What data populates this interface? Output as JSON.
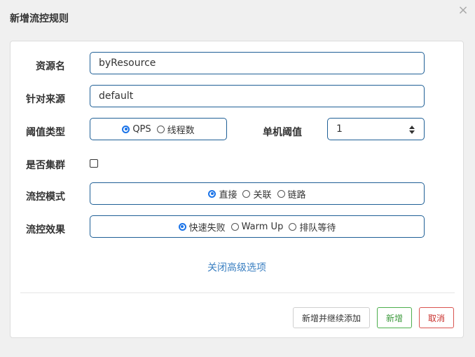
{
  "dialog": {
    "title": "新增流控规则",
    "close_icon": "×"
  },
  "form": {
    "resource": {
      "label": "资源名",
      "value": "byResource"
    },
    "source": {
      "label": "针对来源",
      "value": "default"
    },
    "threshold_type": {
      "label": "阈值类型",
      "options": [
        "QPS",
        "线程数"
      ],
      "selected": "QPS"
    },
    "single_threshold": {
      "label": "单机阈值",
      "value": "1"
    },
    "cluster": {
      "label": "是否集群",
      "checked": false
    },
    "flow_mode": {
      "label": "流控模式",
      "options": [
        "直接",
        "关联",
        "链路"
      ],
      "selected": "直接"
    },
    "flow_effect": {
      "label": "流控效果",
      "options": [
        "快速失败",
        "Warm Up",
        "排队等待"
      ],
      "selected": "快速失败"
    },
    "advanced_toggle": "关闭高级选项"
  },
  "footer": {
    "add_continue_label": "新增并继续添加",
    "add_label": "新增",
    "cancel_label": "取消"
  },
  "colors": {
    "accent": "#1a73e8",
    "field_border": "#1f5f96",
    "link": "#3a7fc1",
    "success": "#4cae4c",
    "danger": "#d9534f"
  }
}
